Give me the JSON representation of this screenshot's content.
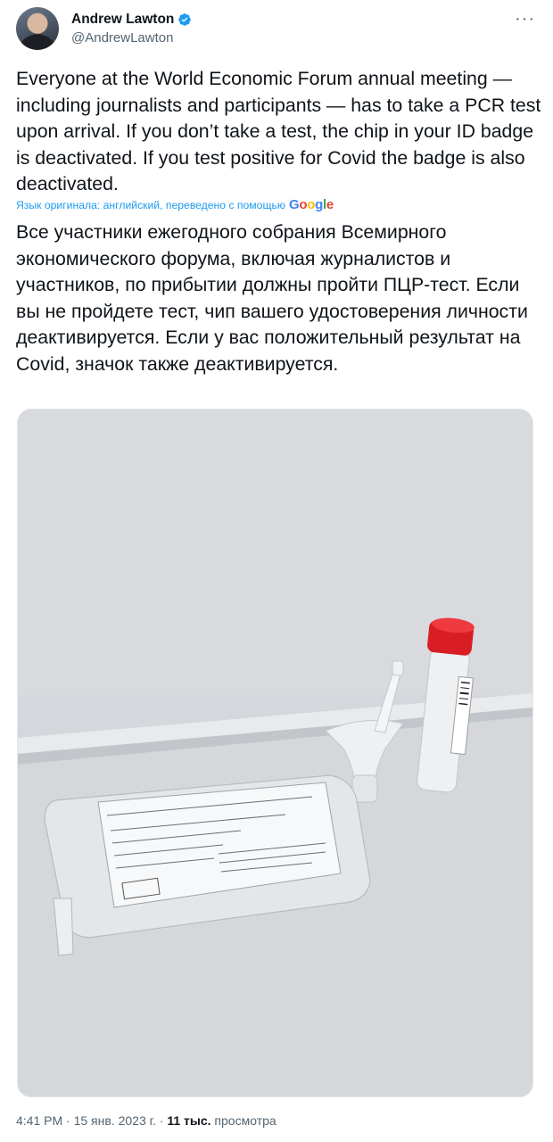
{
  "author": {
    "display_name": "Andrew Lawton",
    "handle": "@AndrewLawton",
    "verified_icon": "verified-badge-icon",
    "avatar": "avatar-photo"
  },
  "more_icon": "more-horizontal-icon",
  "tweet": {
    "text": "Everyone at the World Economic Forum annual meeting — including journalists and participants — has to take a PCR test upon arrival. If you don’t take a test, the chip in your ID badge is deactivated. If you test positive for Covid the badge is also deactivated.",
    "translation_note": "Язык оригинала: английский, переведено с помощью",
    "translated_text": "Все участники ежегодного собрания Всемирного экономического форума, включая журналистов и участников, по прибытии должны пройти ПЦР-тест. Если вы не пройдете тест, чип вашего удостоверения личности деактивируется. Если у вас положительный результат на Covid, значок также деактивируется."
  },
  "google_logo": "Google",
  "colors": {
    "link_blue": "#1d9bf0",
    "secondary_text": "#536471",
    "primary_text": "#0f1419",
    "verified_blue": "#1d9bf0"
  },
  "meta": {
    "time": "4:41 PM",
    "separator1": " · ",
    "date": "15 янв. 2023 г.",
    "separator2": " · ",
    "views_count": "11 тыс.",
    "views_label": " просмотра"
  }
}
